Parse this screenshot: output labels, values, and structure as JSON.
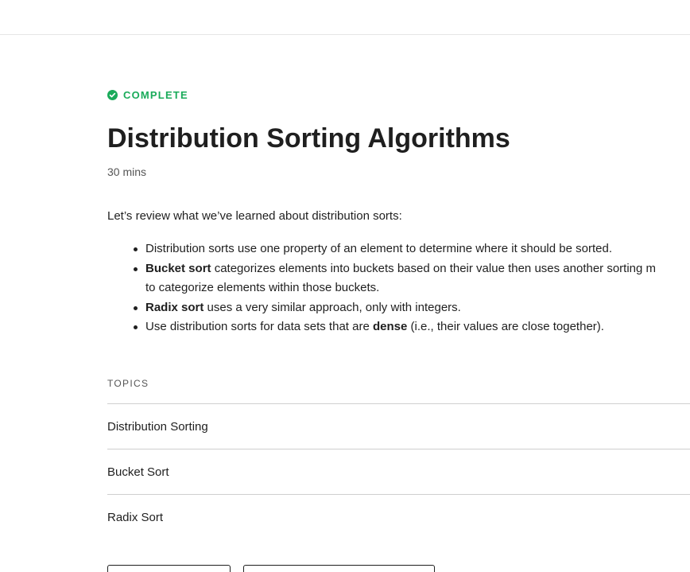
{
  "status": {
    "label": "COMPLETE",
    "icon": "check-circle-icon",
    "color": "#1aab5a"
  },
  "lesson": {
    "title": "Distribution Sorting Algorithms",
    "duration": "30 mins"
  },
  "summary": {
    "intro": "Let’s review what we’ve learned about distribution sorts:",
    "bullets": [
      {
        "bold": "",
        "text": "Distribution sorts use one property of an element to determine where it should be sorted."
      },
      {
        "bold": "Bucket sort",
        "text": " categorizes elements into buckets based on their value then uses another sorting m",
        "continuation": "to categorize elements within those buckets."
      },
      {
        "bold": "Radix sort",
        "text": " uses a very similar approach, only with integers."
      },
      {
        "prefix": "Use distribution sorts for data sets that are ",
        "bold": "dense",
        "text": " (i.e., their values are close together)."
      }
    ]
  },
  "topics": {
    "label": "TOPICS",
    "items": [
      "Distribution Sorting",
      "Bucket Sort",
      "Radix Sort"
    ]
  }
}
